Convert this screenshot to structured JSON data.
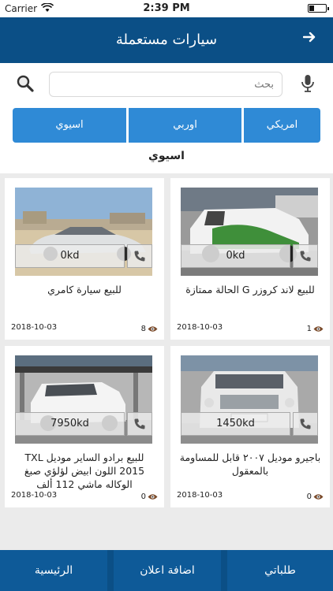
{
  "status_bar": {
    "carrier": "Carrier",
    "time": "2:39 PM"
  },
  "header": {
    "title": "سيارات مستعملة",
    "back_icon": "arrow-right-icon"
  },
  "search": {
    "placeholder": "بحث",
    "value": ""
  },
  "filters": {
    "tabs": [
      {
        "label": "اسيوي"
      },
      {
        "label": "اوربي"
      },
      {
        "label": "امريكي"
      }
    ],
    "selected": "اسيوي"
  },
  "listings": [
    {
      "title": "للبيع سيارة كامري",
      "price": "0kd",
      "date": "2018-10-03",
      "views": "8"
    },
    {
      "title": "للبيع لاند كروزر G الحالة ممتازة",
      "price": "0kd",
      "date": "2018-10-03",
      "views": "1"
    },
    {
      "title": "للبيع برادو الساير موديل TXL 2015 اللون ابيض لؤلؤي صبغ الوكاله ماشي 112 ألف",
      "price": "7950kd",
      "date": "2018-10-03",
      "views": "0"
    },
    {
      "title": "باجيرو موديل ٢٠٠٧ قابل للمساومة بالمعقول",
      "price": "1450kd",
      "date": "2018-10-03",
      "views": "0"
    }
  ],
  "tab_bar": {
    "home": "الرئيسية",
    "add_ad": "اضافة اعلان",
    "my_orders": "طلباتي"
  },
  "colors": {
    "header": "#0b4f86",
    "filter_tab": "#2f8ad6",
    "background": "#ebebeb"
  }
}
